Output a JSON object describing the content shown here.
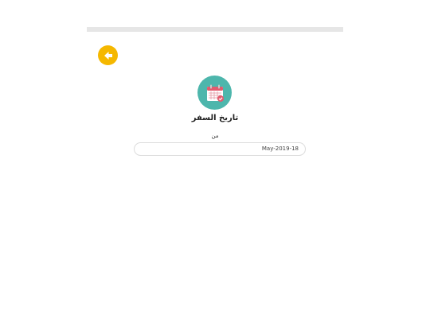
{
  "header": {
    "back_icon": "arrow-left-icon",
    "accent": "#f5b800"
  },
  "section": {
    "icon": "calendar-icon",
    "icon_bg": "#4db6ac",
    "title": "تاريخ السفر",
    "from_label": "من",
    "date_value": "May-2019-18"
  }
}
